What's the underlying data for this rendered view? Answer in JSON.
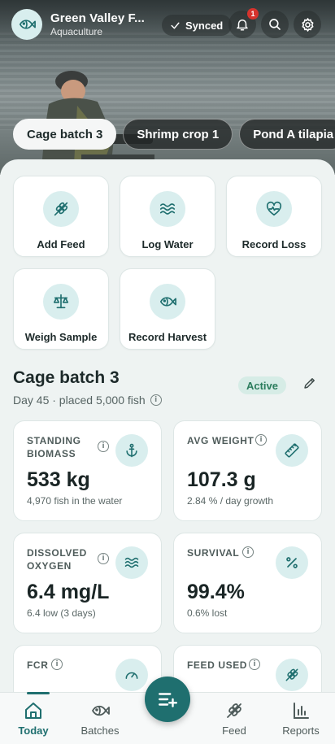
{
  "header": {
    "farm_name": "Green Valley F...",
    "farm_type": "Aquaculture",
    "sync_status": "Synced",
    "notification_count": "1"
  },
  "tabs": [
    {
      "label": "Cage batch 3",
      "active": true
    },
    {
      "label": "Shrimp crop 1",
      "active": false
    },
    {
      "label": "Pond A tilapia",
      "active": false
    }
  ],
  "quick_actions": [
    {
      "label": "Add Feed",
      "icon": "feed-icon"
    },
    {
      "label": "Log Water",
      "icon": "water-icon"
    },
    {
      "label": "Record Loss",
      "icon": "heart-pulse-icon"
    },
    {
      "label": "Weigh Sample",
      "icon": "scale-icon"
    },
    {
      "label": "Record Harvest",
      "icon": "fish-icon"
    }
  ],
  "batch": {
    "title": "Cage batch 3",
    "subtitle": "Day 45 · placed 5,000 fish",
    "status": "Active"
  },
  "stats": [
    {
      "label": "STANDING BIOMASS",
      "value": "533 kg",
      "note": "4,970 fish in the water",
      "icon": "anchor-icon"
    },
    {
      "label": "AVG WEIGHT",
      "value": "107.3 g",
      "note": "2.84 % / day growth",
      "icon": "ruler-icon"
    },
    {
      "label": "DISSOLVED OXYGEN",
      "value": "6.4 mg/L",
      "note": "6.4 low (3 days)",
      "icon": "water-icon"
    },
    {
      "label": "SURVIVAL",
      "value": "99.4%",
      "note": "0.6% lost",
      "icon": "percent-icon"
    },
    {
      "label": "FCR",
      "value": "",
      "note": "",
      "icon": "gauge-icon"
    },
    {
      "label": "FEED USED",
      "value": "",
      "note": "",
      "icon": "feed-icon"
    }
  ],
  "nav": {
    "items": [
      {
        "label": "Today",
        "active": true
      },
      {
        "label": "Batches",
        "active": false
      },
      {
        "label": "Feed",
        "active": false
      },
      {
        "label": "Reports",
        "active": false
      }
    ]
  },
  "colors": {
    "accent": "#1f6f6f",
    "icon_bg": "#d9eeee",
    "status_active_bg": "#d6ece6",
    "status_active_text": "#2b7d5d",
    "badge": "#d6332d"
  }
}
